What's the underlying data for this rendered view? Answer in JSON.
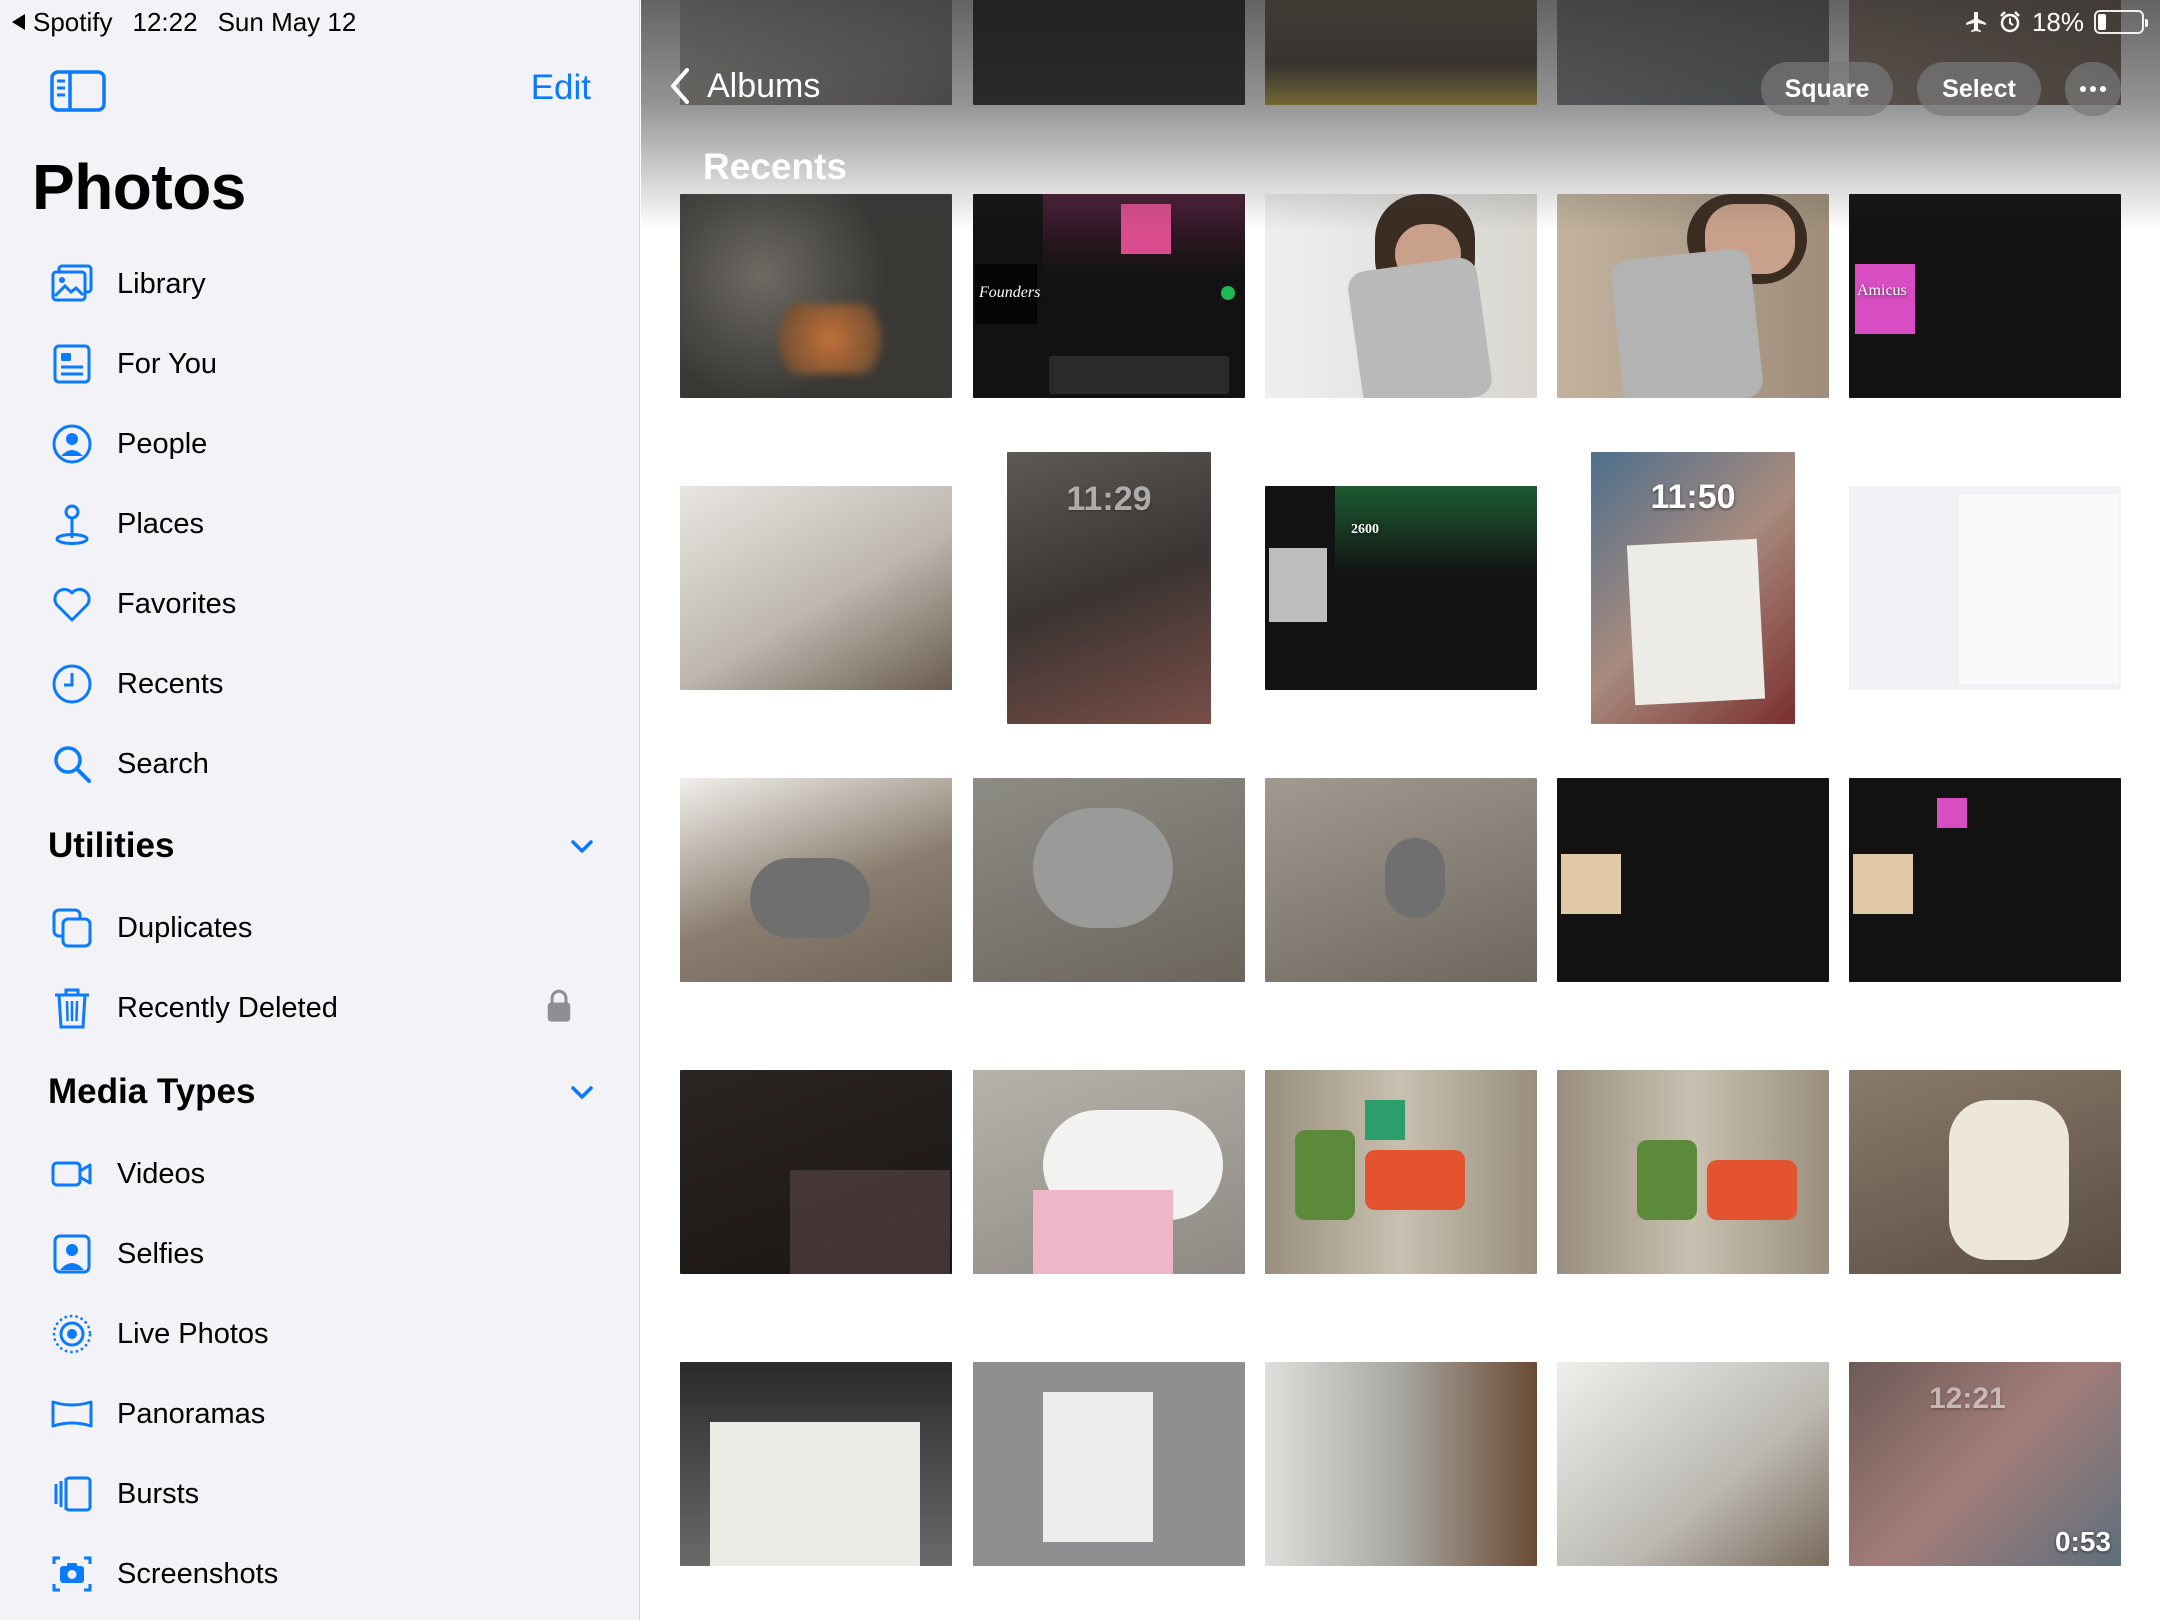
{
  "statusbar": {
    "back_app": "Spotify",
    "time": "12:22",
    "date": "Sun May 12",
    "battery_percent": "18%",
    "battery_level": 0.18
  },
  "sidebar": {
    "edit_label": "Edit",
    "title": "Photos",
    "items": [
      {
        "label": "Library",
        "icon": "library-icon"
      },
      {
        "label": "For You",
        "icon": "for-you-icon"
      },
      {
        "label": "People",
        "icon": "people-icon"
      },
      {
        "label": "Places",
        "icon": "places-icon"
      },
      {
        "label": "Favorites",
        "icon": "heart-icon"
      },
      {
        "label": "Recents",
        "icon": "clock-icon"
      },
      {
        "label": "Search",
        "icon": "search-icon"
      }
    ],
    "utilities": {
      "title": "Utilities",
      "items": [
        {
          "label": "Duplicates",
          "icon": "duplicates-icon"
        },
        {
          "label": "Recently Deleted",
          "icon": "trash-icon",
          "locked": true
        }
      ]
    },
    "media_types": {
      "title": "Media Types",
      "items": [
        {
          "label": "Videos",
          "icon": "video-icon"
        },
        {
          "label": "Selfies",
          "icon": "selfie-icon"
        },
        {
          "label": "Live Photos",
          "icon": "live-photo-icon"
        },
        {
          "label": "Panoramas",
          "icon": "panorama-icon"
        },
        {
          "label": "Bursts",
          "icon": "bursts-icon"
        },
        {
          "label": "Screenshots",
          "icon": "screenshot-icon"
        }
      ]
    }
  },
  "main": {
    "back_label": "Albums",
    "section_title": "Recents",
    "square_label": "Square",
    "select_label": "Select",
    "photo_overlays": {
      "lock_time_1": "11:29",
      "lock_time_2": "11:50",
      "lock_time_3": "12:21",
      "video_duration": "0:53",
      "founders": "Founders",
      "amicus": "Amicus",
      "number_2600": "2600"
    }
  },
  "colors": {
    "accent": "#0a7aff",
    "sidebar_bg": "#f2f2f7",
    "spotify_green": "#1db954"
  }
}
